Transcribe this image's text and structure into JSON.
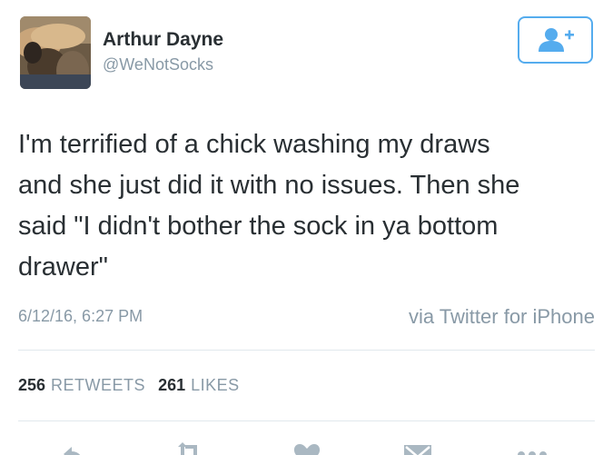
{
  "user": {
    "name": "Arthur Dayne",
    "handle": "@WeNotSocks"
  },
  "tweet": {
    "text": "I'm terrified of a chick washing my draws\nand she just did it with no issues. Then she\nsaid \"I didn't bother the sock in ya bottom\ndrawer\"",
    "timestamp": "6/12/16, 6:27 PM",
    "source": "via Twitter for iPhone"
  },
  "stats": {
    "retweets_count": "256",
    "retweets_label": "RETWEETS",
    "likes_count": "261",
    "likes_label": "LIKES"
  },
  "icons": {
    "follow": "follow-icon",
    "reply": "reply-icon",
    "retweet": "retweet-icon",
    "like": "heart-icon",
    "message": "envelope-icon",
    "more": "more-icon"
  },
  "colors": {
    "accent": "#55acee",
    "muted": "#8899a6",
    "text": "#292f33",
    "divider": "#e1e8ed"
  }
}
